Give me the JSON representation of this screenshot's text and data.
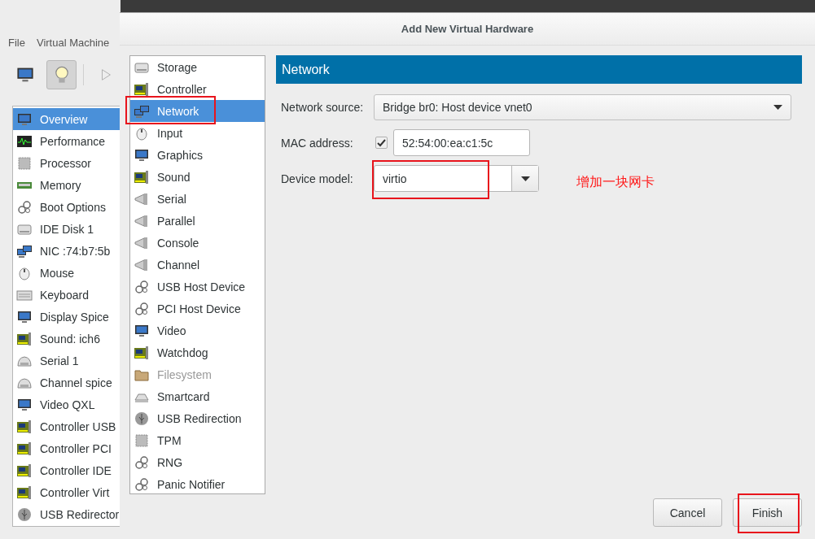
{
  "main_window": {
    "menu": [
      {
        "label": "File"
      },
      {
        "label": "Virtual Machine"
      }
    ],
    "toolbar": [
      {
        "kind": "monitor",
        "pressed": false
      },
      {
        "kind": "bulb",
        "pressed": true
      },
      {
        "kind": "play",
        "pressed": false
      }
    ],
    "items": [
      {
        "label": "Overview",
        "kind": "monitor",
        "selected": true
      },
      {
        "label": "Performance",
        "kind": "chart",
        "selected": false
      },
      {
        "label": "Processor",
        "kind": "chip",
        "selected": false
      },
      {
        "label": "Memory",
        "kind": "memory",
        "selected": false
      },
      {
        "label": "Boot Options",
        "kind": "gears",
        "selected": false
      },
      {
        "label": "IDE Disk 1",
        "kind": "disk",
        "selected": false
      },
      {
        "label": "NIC :74:b7:5b",
        "kind": "network",
        "selected": false
      },
      {
        "label": "Mouse",
        "kind": "mouse",
        "selected": false
      },
      {
        "label": "Keyboard",
        "kind": "keyboard",
        "selected": false
      },
      {
        "label": "Display Spice",
        "kind": "monitor",
        "selected": false
      },
      {
        "label": "Sound: ich6",
        "kind": "board",
        "selected": false
      },
      {
        "label": "Serial 1",
        "kind": "cable",
        "selected": false
      },
      {
        "label": "Channel spice",
        "kind": "cable",
        "selected": false
      },
      {
        "label": "Video QXL",
        "kind": "monitor",
        "selected": false
      },
      {
        "label": "Controller USB",
        "kind": "board",
        "selected": false
      },
      {
        "label": "Controller PCI",
        "kind": "board",
        "selected": false
      },
      {
        "label": "Controller IDE",
        "kind": "board",
        "selected": false
      },
      {
        "label": "Controller Virt",
        "kind": "board",
        "selected": false
      },
      {
        "label": "USB Redirector",
        "kind": "usb",
        "selected": false
      }
    ]
  },
  "dialog": {
    "title": "Add New Virtual Hardware",
    "devices": [
      {
        "label": "Storage",
        "kind": "disk",
        "selected": false,
        "disabled": false,
        "highlighted": false
      },
      {
        "label": "Controller",
        "kind": "board",
        "selected": false,
        "disabled": false,
        "highlighted": false
      },
      {
        "label": "Network",
        "kind": "network",
        "selected": true,
        "disabled": false,
        "highlighted": true
      },
      {
        "label": "Input",
        "kind": "mouse",
        "selected": false,
        "disabled": false,
        "highlighted": false
      },
      {
        "label": "Graphics",
        "kind": "monitor",
        "selected": false,
        "disabled": false,
        "highlighted": false
      },
      {
        "label": "Sound",
        "kind": "board",
        "selected": false,
        "disabled": false,
        "highlighted": false
      },
      {
        "label": "Serial",
        "kind": "plug",
        "selected": false,
        "disabled": false,
        "highlighted": false
      },
      {
        "label": "Parallel",
        "kind": "plug",
        "selected": false,
        "disabled": false,
        "highlighted": false
      },
      {
        "label": "Console",
        "kind": "plug",
        "selected": false,
        "disabled": false,
        "highlighted": false
      },
      {
        "label": "Channel",
        "kind": "plug",
        "selected": false,
        "disabled": false,
        "highlighted": false
      },
      {
        "label": "USB Host Device",
        "kind": "gears",
        "selected": false,
        "disabled": false,
        "highlighted": false
      },
      {
        "label": "PCI Host Device",
        "kind": "gears",
        "selected": false,
        "disabled": false,
        "highlighted": false
      },
      {
        "label": "Video",
        "kind": "monitor",
        "selected": false,
        "disabled": false,
        "highlighted": false
      },
      {
        "label": "Watchdog",
        "kind": "board",
        "selected": false,
        "disabled": false,
        "highlighted": false
      },
      {
        "label": "Filesystem",
        "kind": "folder",
        "selected": false,
        "disabled": true,
        "highlighted": false
      },
      {
        "label": "Smartcard",
        "kind": "reader",
        "selected": false,
        "disabled": false,
        "highlighted": false
      },
      {
        "label": "USB Redirection",
        "kind": "usb",
        "selected": false,
        "disabled": false,
        "highlighted": false
      },
      {
        "label": "TPM",
        "kind": "chip",
        "selected": false,
        "disabled": false,
        "highlighted": false
      },
      {
        "label": "RNG",
        "kind": "gears",
        "selected": false,
        "disabled": false,
        "highlighted": false
      },
      {
        "label": "Panic Notifier",
        "kind": "gears",
        "selected": false,
        "disabled": false,
        "highlighted": false
      }
    ],
    "header": "Network",
    "network_source": {
      "label": "Network source:",
      "value": "Bridge br0: Host device vnet0"
    },
    "mac_address": {
      "label": "MAC address:",
      "checked": true,
      "value": "52:54:00:ea:c1:5c"
    },
    "device_model": {
      "label": "Device model:",
      "value": "virtio",
      "highlighted": true
    },
    "annotation": "增加一块网卡",
    "buttons": [
      {
        "label": "Cancel",
        "highlighted": false
      },
      {
        "label": "Finish",
        "highlighted": true
      }
    ]
  }
}
